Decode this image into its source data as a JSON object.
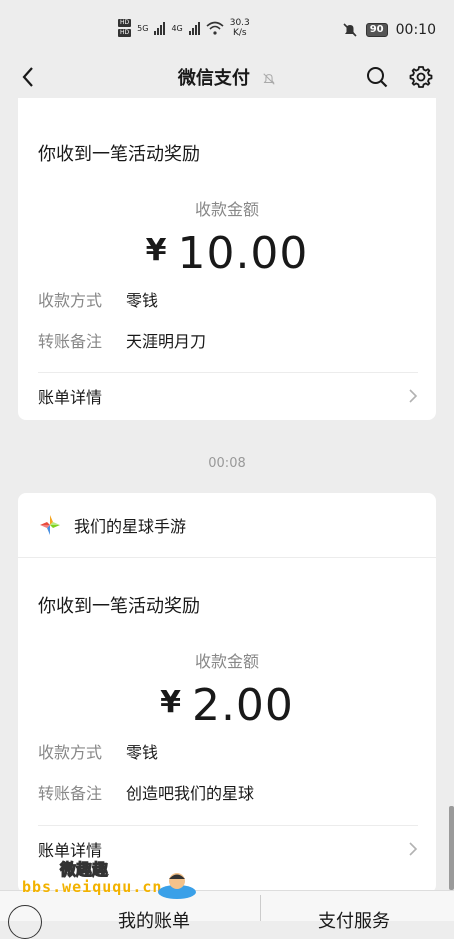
{
  "status_bar": {
    "hd_labels": [
      "HD",
      "HD"
    ],
    "network_1": "5G",
    "network_2": "4G",
    "speed_value": "30.3",
    "speed_unit": "K/s",
    "battery": "90",
    "time": "00:10"
  },
  "nav": {
    "title": "微信支付",
    "back_icon": "chevron-left-icon",
    "search_icon": "search-icon",
    "settings_icon": "gear-icon"
  },
  "messages": [
    {
      "heading": "你收到一笔活动奖励",
      "amount_label": "收款金额",
      "currency": "¥",
      "amount": "10.00",
      "method_label": "收款方式",
      "method_value": "零钱",
      "remark_label": "转账备注",
      "remark_value": "天涯明月刀",
      "detail_label": "账单详情"
    },
    {
      "merchant": "我们的星球手游",
      "heading": "你收到一笔活动奖励",
      "amount_label": "收款金额",
      "currency": "¥",
      "amount": "2.00",
      "method_label": "收款方式",
      "method_value": "零钱",
      "remark_label": "转账备注",
      "remark_value": "创造吧我们的星球",
      "detail_label": "账单详情"
    }
  ],
  "timestamp": "00:08",
  "bottom_bar": {
    "item_1": "我的账单",
    "item_2": "支付服务"
  },
  "watermark": {
    "brand": "微趣趣",
    "url": "bbs.weiququ.cn"
  },
  "colors": {
    "background": "#ededed",
    "card": "#ffffff",
    "muted_text": "#888888",
    "watermark_url": "#f2b200"
  }
}
